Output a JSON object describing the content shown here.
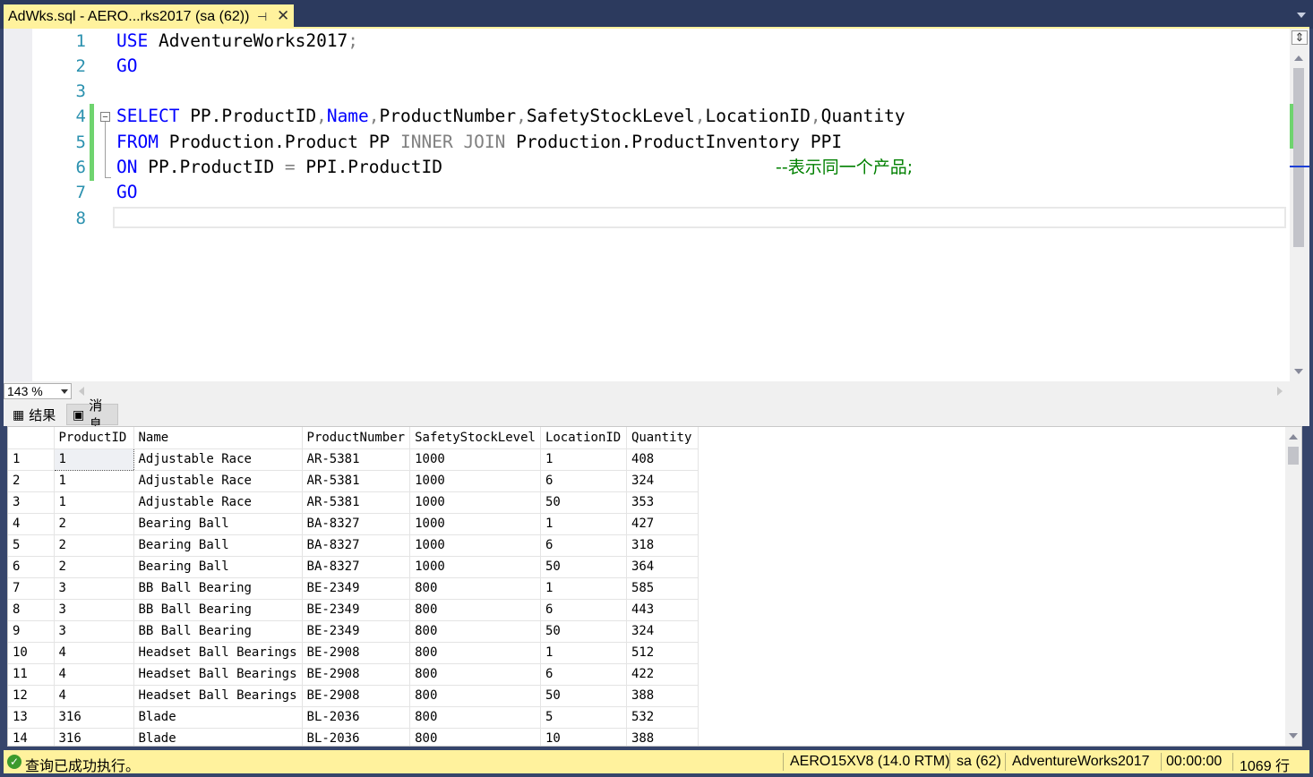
{
  "tab": {
    "title": "AdWks.sql - AERO...rks2017 (sa (62))",
    "pin": "⊣",
    "close": "✕"
  },
  "editor": {
    "line_numbers": [
      "1",
      "2",
      "3",
      "4",
      "5",
      "6",
      "7",
      "8"
    ],
    "l1": {
      "kw": "USE",
      "rest": " AdventureWorks2017",
      "semi": ";"
    },
    "l2": {
      "kw": "GO"
    },
    "l4": {
      "kw": "SELECT",
      "a": " PP.ProductID",
      "c1": ",",
      "name": "Name",
      "c2": ",",
      "b": "ProductNumber",
      "c3": ",",
      "c": "SafetyStockLevel",
      "c4": ",",
      "d": "LocationID",
      "c5": ",",
      "e": "Quantity"
    },
    "l5": {
      "kw": "FROM",
      "a": " Production.Product PP ",
      "join": "INNER JOIN",
      "b": " Production.ProductInventory PPI"
    },
    "l6": {
      "kw": "ON",
      "a": " PP.ProductID ",
      "eq": "=",
      "b": " PPI.ProductID",
      "comment": "--表示同一个产品;"
    },
    "l7": {
      "kw": "GO"
    }
  },
  "zoom": "143 %",
  "results_tabs": [
    {
      "label": "结果",
      "icon": "grid-icon"
    },
    {
      "label": "消息",
      "icon": "message-icon"
    }
  ],
  "grid": {
    "columns": [
      "ProductID",
      "Name",
      "ProductNumber",
      "SafetyStockLevel",
      "LocationID",
      "Quantity"
    ],
    "rows": [
      [
        "1",
        "1",
        "Adjustable Race",
        "AR-5381",
        "1000",
        "1",
        "408"
      ],
      [
        "2",
        "1",
        "Adjustable Race",
        "AR-5381",
        "1000",
        "6",
        "324"
      ],
      [
        "3",
        "1",
        "Adjustable Race",
        "AR-5381",
        "1000",
        "50",
        "353"
      ],
      [
        "4",
        "2",
        "Bearing Ball",
        "BA-8327",
        "1000",
        "1",
        "427"
      ],
      [
        "5",
        "2",
        "Bearing Ball",
        "BA-8327",
        "1000",
        "6",
        "318"
      ],
      [
        "6",
        "2",
        "Bearing Ball",
        "BA-8327",
        "1000",
        "50",
        "364"
      ],
      [
        "7",
        "3",
        "BB Ball Bearing",
        "BE-2349",
        "800",
        "1",
        "585"
      ],
      [
        "8",
        "3",
        "BB Ball Bearing",
        "BE-2349",
        "800",
        "6",
        "443"
      ],
      [
        "9",
        "3",
        "BB Ball Bearing",
        "BE-2349",
        "800",
        "50",
        "324"
      ],
      [
        "10",
        "4",
        "Headset Ball Bearings",
        "BE-2908",
        "800",
        "1",
        "512"
      ],
      [
        "11",
        "4",
        "Headset Ball Bearings",
        "BE-2908",
        "800",
        "6",
        "422"
      ],
      [
        "12",
        "4",
        "Headset Ball Bearings",
        "BE-2908",
        "800",
        "50",
        "388"
      ],
      [
        "13",
        "316",
        "Blade",
        "BL-2036",
        "800",
        "5",
        "532"
      ],
      [
        "14",
        "316",
        "Blade",
        "BL-2036",
        "800",
        "10",
        "388"
      ]
    ]
  },
  "status": {
    "message": "查询已成功执行。",
    "server": "AERO15XV8 (14.0 RTM)",
    "user": "sa (62)",
    "database": "AdventureWorks2017",
    "time": "00:00:00",
    "rows": "1069 行"
  }
}
